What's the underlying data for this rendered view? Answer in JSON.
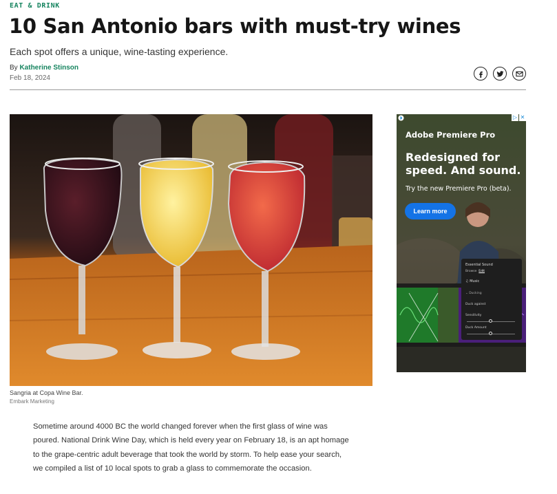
{
  "article": {
    "kicker": "EAT & DRINK",
    "headline": "10 San Antonio bars with must-try wines",
    "dek": "Each spot offers a unique, wine-tasting experience.",
    "byline_prefix": "By ",
    "author": "Katherine Stinson",
    "date": "Feb 18, 2024",
    "image_caption": "Sangria at Copa Wine Bar.",
    "image_credit": "Embark Marketing",
    "body": "Sometime around 4000 BC the world changed forever when the first glass of wine was poured. National Drink Wine Day, which is held every year on February 18, is an apt homage to the grape-centric adult beverage that took the world by storm. To help ease your search, we compiled a list of 10 local spots to grab a glass to commemorate the occasion."
  },
  "share": {
    "icons": [
      "facebook-icon",
      "twitter-icon",
      "email-icon"
    ]
  },
  "ad": {
    "brand": "Adobe Premiere Pro",
    "headline": "Redesigned for speed. And sound.",
    "sub": "Try the new Premiere Pro (beta).",
    "cta": "Learn more",
    "panel": {
      "title": "Essential Sound",
      "tab_browse": "Browse",
      "tab_edit": "Edit",
      "music": "Music",
      "ducking": "Ducking",
      "duck_against": "Duck against",
      "sensitivity": "Sensitivity",
      "duck_amount": "Duck Amount"
    }
  },
  "colors": {
    "accent": "#16845f",
    "ad_button": "#1473e6"
  }
}
